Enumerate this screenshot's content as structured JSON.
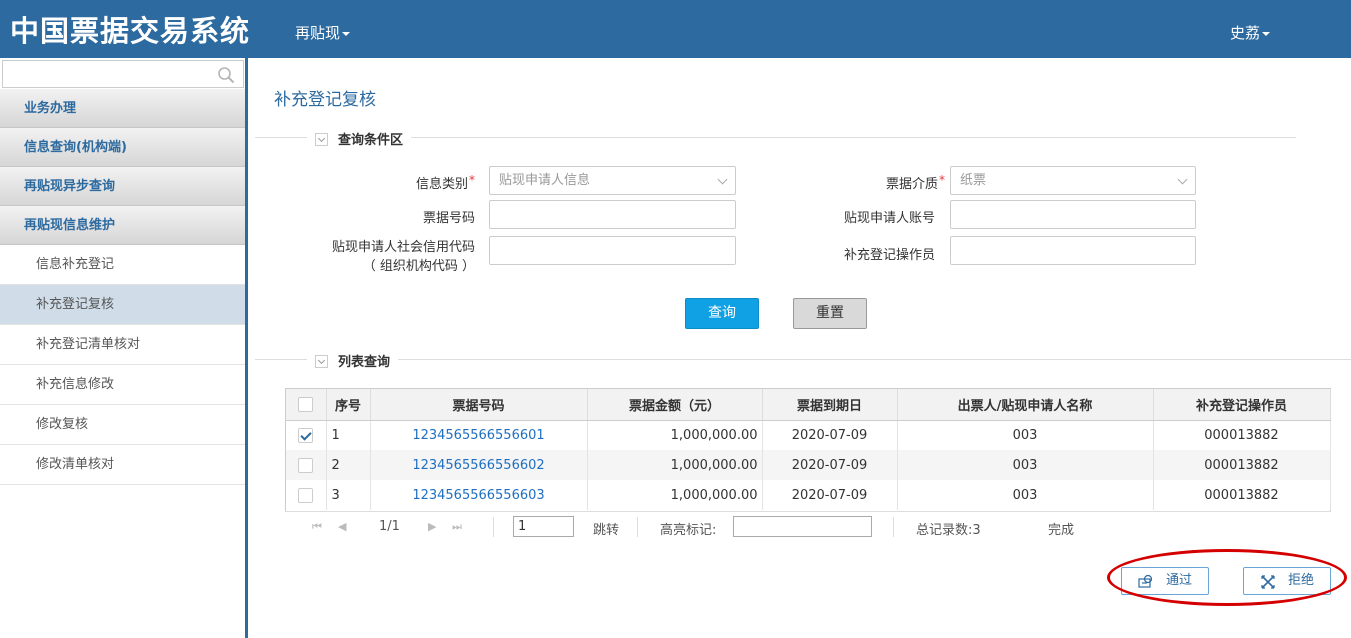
{
  "header": {
    "app_title": "中国票据交易系统",
    "nav_menu": "再贴现",
    "user_name": "史荔"
  },
  "sidebar": {
    "search_placeholder": "",
    "groups": [
      "业务办理",
      "信息查询(机构端)",
      "再贴现异步查询",
      "再贴现信息维护"
    ],
    "items": [
      "信息补充登记",
      "补充登记复核",
      "补充登记清单核对",
      "补充信息修改",
      "修改复核",
      "修改清单核对"
    ]
  },
  "main": {
    "page_title": "补充登记复核",
    "query_section": "查询条件区",
    "list_section": "列表查询",
    "form": {
      "info_type_label": "信息类别",
      "info_type_value": "贴现申请人信息",
      "medium_label": "票据介质",
      "medium_value": "纸票",
      "bill_no_label": "票据号码",
      "account_label": "贴现申请人账号",
      "credit_code_label_1": "贴现申请人社会信用代码",
      "credit_code_label_2": "（ 组织机构代码 ）",
      "operator_label": "补充登记操作员"
    },
    "query_button": "查询",
    "reset_button": "重置"
  },
  "table": {
    "columns": [
      "序号",
      "票据号码",
      "票据金额（元）",
      "票据到期日",
      "出票人/贴现申请人名称",
      "补充登记操作员"
    ],
    "rows": [
      {
        "checked": true,
        "seq": "1",
        "bill_no": "1234565566556601",
        "amount": "1,000,000.00",
        "due": "2020-07-09",
        "drawer": "003",
        "operator": "000013882"
      },
      {
        "checked": false,
        "seq": "2",
        "bill_no": "1234565566556602",
        "amount": "1,000,000.00",
        "due": "2020-07-09",
        "drawer": "003",
        "operator": "000013882"
      },
      {
        "checked": false,
        "seq": "3",
        "bill_no": "1234565566556603",
        "amount": "1,000,000.00",
        "due": "2020-07-09",
        "drawer": "003",
        "operator": "000013882"
      }
    ]
  },
  "pager": {
    "page_info": "1/1",
    "page_input": "1",
    "jump": "跳转",
    "highlight_label": "高亮标记:",
    "total": "总记录数:3",
    "status": "完成"
  },
  "actions": {
    "approve": "通过",
    "reject": "拒绝"
  },
  "colors": {
    "header_bg": "#2d6a9f",
    "primary_button": "#0fa1e4",
    "annotation_oval": "#d40000"
  }
}
